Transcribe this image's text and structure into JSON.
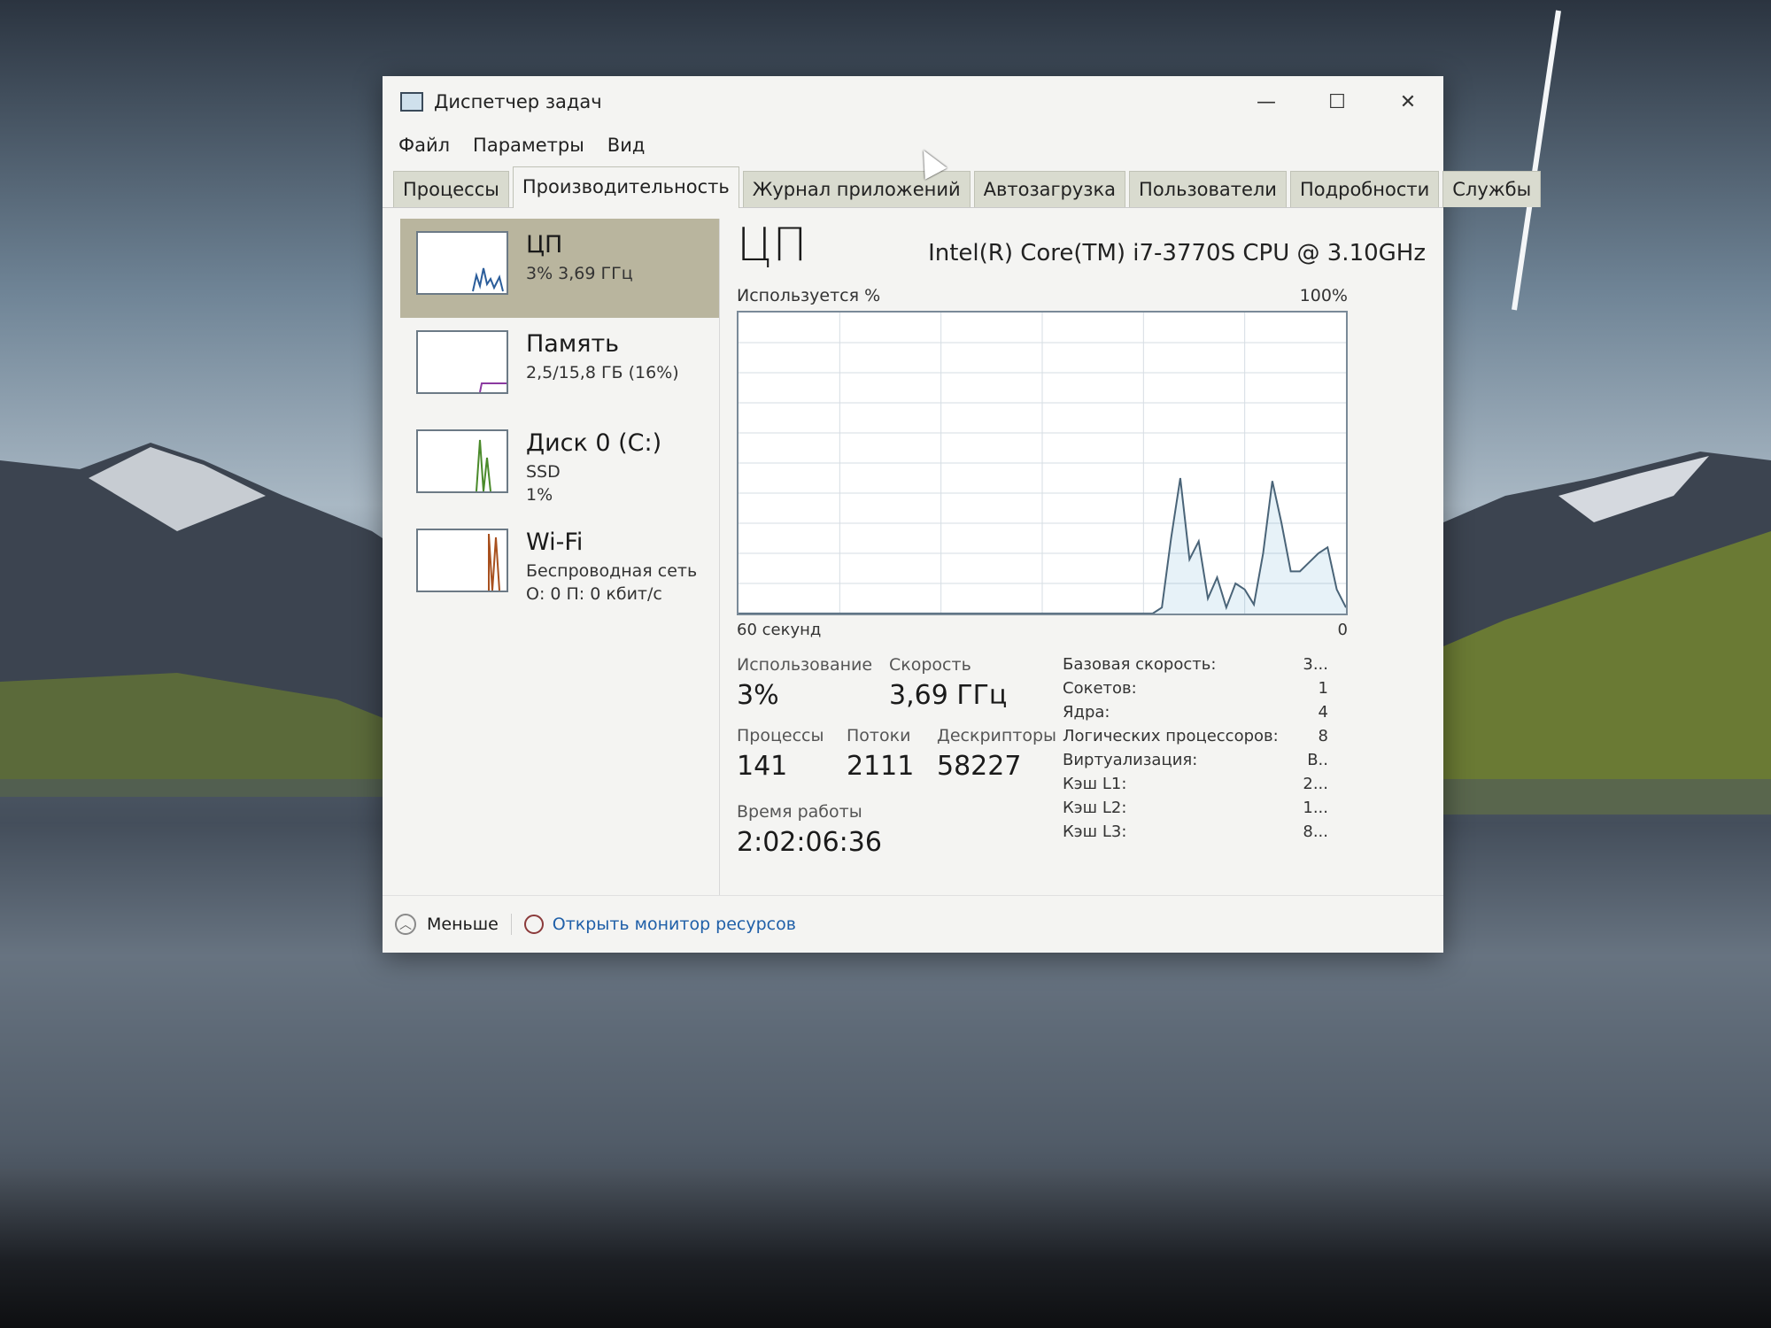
{
  "window": {
    "title": "Диспетчер задач",
    "controls": {
      "minimize": "—",
      "maximize": "☐",
      "close": "✕"
    }
  },
  "menu": [
    "Файл",
    "Параметры",
    "Вид"
  ],
  "tabs": [
    "Процессы",
    "Производительность",
    "Журнал приложений",
    "Автозагрузка",
    "Пользователи",
    "Подробности",
    "Службы"
  ],
  "active_tab_index": 1,
  "sidebar": [
    {
      "name": "ЦП",
      "line1": "3% 3,69 ГГц",
      "line2": "",
      "color": "#2b5d9a"
    },
    {
      "name": "Память",
      "line1": "2,5/15,8 ГБ (16%)",
      "line2": "",
      "color": "#8b3aa0"
    },
    {
      "name": "Диск 0 (C:)",
      "line1": "SSD",
      "line2": "1%",
      "color": "#4a8a2a"
    },
    {
      "name": "Wi-Fi",
      "line1": "Беспроводная сеть",
      "line2": "О: 0 П: 0 кбит/с",
      "color": "#a8501e"
    }
  ],
  "main": {
    "title": "ЦП",
    "model": "Intel(R) Core(TM) i7-3770S CPU @ 3.10GHz",
    "graph_label_left": "Используется %",
    "graph_label_right": "100%",
    "graph_foot_left": "60 секунд",
    "graph_foot_right": "0",
    "usage_series": [
      0,
      0,
      0,
      0,
      0,
      0,
      0,
      0,
      0,
      0,
      0,
      0,
      0,
      0,
      0,
      0,
      0,
      0,
      0,
      0,
      0,
      0,
      0,
      0,
      0,
      0,
      0,
      0,
      0,
      0,
      0,
      0,
      0,
      0,
      0,
      0,
      0,
      0,
      0,
      0,
      0,
      0,
      0,
      0,
      0,
      0,
      2,
      25,
      45,
      18,
      24,
      5,
      12,
      2,
      10,
      8,
      3,
      20,
      44,
      30,
      14,
      14,
      17,
      20,
      22,
      8,
      2
    ],
    "stats": {
      "usage_label": "Использование",
      "usage_value": "3%",
      "speed_label": "Скорость",
      "speed_value": "3,69 ГГц",
      "processes_label": "Процессы",
      "processes_value": "141",
      "threads_label": "Потоки",
      "threads_value": "2111",
      "handles_label": "Дескрипторы",
      "handles_value": "58227",
      "uptime_label": "Время работы",
      "uptime_value": "2:02:06:36"
    },
    "details": [
      {
        "k": "Базовая скорость:",
        "v": "3..."
      },
      {
        "k": "Сокетов:",
        "v": "1"
      },
      {
        "k": "Ядра:",
        "v": "4"
      },
      {
        "k": "Логических процессоров:",
        "v": "8"
      },
      {
        "k": "Виртуализация:",
        "v": "В.."
      },
      {
        "k": "Кэш L1:",
        "v": "2..."
      },
      {
        "k": "Кэш L2:",
        "v": "1..."
      },
      {
        "k": "Кэш L3:",
        "v": "8..."
      }
    ]
  },
  "footer": {
    "less": "Меньше",
    "monitor_link": "Открыть монитор ресурсов"
  }
}
